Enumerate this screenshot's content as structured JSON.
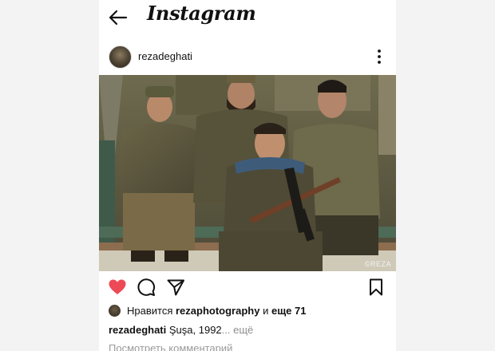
{
  "app": {
    "logo_text": "Instagram"
  },
  "post": {
    "author": "rezadeghati",
    "photo_watermark": "©REZA",
    "likes": {
      "prefix": "Нравится",
      "first_user": "rezaphotography",
      "conjunction": "и",
      "others": "еще 71"
    },
    "caption": {
      "author": "rezadeghati",
      "text": "Şuşa, 1992",
      "ellipsis": "...",
      "more_label": "ещё"
    },
    "view_comments_label": "Посмотреть комментарий"
  },
  "actions": {
    "liked": true,
    "like_color": "#ed4956"
  },
  "icons": [
    "back-arrow-icon",
    "more-vertical-icon",
    "heart-icon",
    "comment-icon",
    "share-icon",
    "bookmark-icon"
  ]
}
